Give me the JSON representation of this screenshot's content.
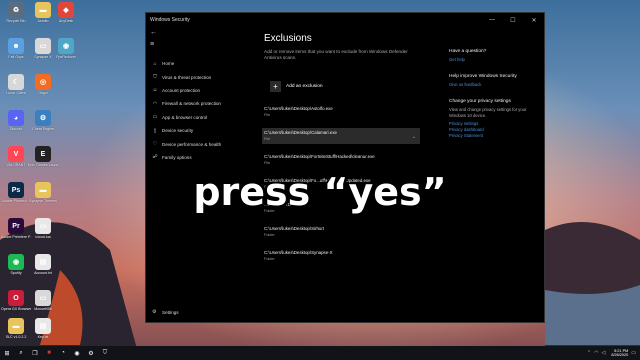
{
  "desktop": {
    "icons": [
      {
        "label": "Recycle Bin",
        "icon": "recycle-bin-icon",
        "color": "#5b6c7d",
        "glyph": "♻"
      },
      {
        "label": "Astolfo",
        "icon": "folder-icon",
        "color": "#e8c45c",
        "glyph": "▬"
      },
      {
        "label": "AnyDesk",
        "icon": "anydesk-icon",
        "color": "#e0463b",
        "glyph": "◆"
      },
      {
        "label": "Fall Guys",
        "icon": "fall-guys-icon",
        "color": "#5aa0e0",
        "glyph": "☻"
      },
      {
        "label": "Synapse X",
        "icon": "file-icon",
        "color": "#d8d8d8",
        "glyph": "▭"
      },
      {
        "label": "FpsReducer",
        "icon": "fps-reducer-icon",
        "color": "#4fa7c7",
        "glyph": "◉"
      },
      {
        "label": "Lunar Client",
        "icon": "lunar-client-icon",
        "color": "#d8d8d8",
        "glyph": "☾"
      },
      {
        "label": "Origin",
        "icon": "origin-icon",
        "color": "#f26c22",
        "glyph": "◎"
      },
      {
        "label": "Discord",
        "icon": "discord-icon",
        "color": "#5865f2",
        "glyph": "◕"
      },
      {
        "label": "Cheat Engine",
        "icon": "cheat-engine-icon",
        "color": "#3a80c0",
        "glyph": "⚙"
      },
      {
        "label": "VALORANT",
        "icon": "valorant-icon",
        "color": "#ff4655",
        "glyph": "V"
      },
      {
        "label": "Epic Games Launcher",
        "icon": "epic-games-icon",
        "color": "#222222",
        "glyph": "E"
      },
      {
        "label": "Adobe Photosh...",
        "icon": "photoshop-icon",
        "color": "#0b2a4a",
        "glyph": "Ps"
      },
      {
        "label": "Synapse Themes",
        "icon": "folder-icon",
        "color": "#e8c45c",
        "glyph": "▬"
      },
      {
        "label": "Adobe Premiere P...",
        "icon": "premiere-icon",
        "color": "#2a0a3a",
        "glyph": "Pr"
      },
      {
        "label": "icloud.lua",
        "icon": "file-icon",
        "color": "#e8e8e8",
        "glyph": "▭"
      },
      {
        "label": "Spotify",
        "icon": "spotify-icon",
        "color": "#1db954",
        "glyph": "◉"
      },
      {
        "label": "Account.txt",
        "icon": "text-file-icon",
        "color": "#e8e8e8",
        "glyph": "▤"
      },
      {
        "label": "Opera GX Browser",
        "icon": "opera-gx-icon",
        "color": "#c81e3c",
        "glyph": "O"
      },
      {
        "label": "MouseKillit",
        "icon": "mouse-icon",
        "color": "#d8d8d8",
        "glyph": "▭"
      },
      {
        "label": "SLC v1.0.2.2",
        "icon": "folder-icon",
        "color": "#e8c45c",
        "glyph": "▬"
      },
      {
        "label": "Key.txt",
        "icon": "text-file-icon",
        "color": "#e8e8e8",
        "glyph": "▤"
      }
    ]
  },
  "window": {
    "title": "Windows Security",
    "minimize": "—",
    "maximize": "☐",
    "close": "✕",
    "back": "←",
    "menu": "≡"
  },
  "sidebar": {
    "items": [
      {
        "label": "Home",
        "icon": "home-icon",
        "glyph": "⌂"
      },
      {
        "label": "Virus & threat protection",
        "icon": "shield-icon",
        "glyph": "⛉"
      },
      {
        "label": "Account protection",
        "icon": "account-icon",
        "glyph": "☺"
      },
      {
        "label": "Firewall & network protection",
        "icon": "network-icon",
        "glyph": "◠"
      },
      {
        "label": "App & browser control",
        "icon": "app-browser-icon",
        "glyph": "▭"
      },
      {
        "label": "Device security",
        "icon": "device-security-icon",
        "glyph": "▯"
      },
      {
        "label": "Device performance & health",
        "icon": "heart-icon",
        "glyph": "♡"
      },
      {
        "label": "Family options",
        "icon": "family-icon",
        "glyph": "☍"
      }
    ],
    "settings": {
      "label": "Settings",
      "icon": "gear-icon",
      "glyph": "⚙"
    }
  },
  "main": {
    "title": "Exclusions",
    "description": "Add or remove items that you want to exclude from Windows Defender Antivirus scans.",
    "add_label": "Add an exclusion",
    "add_glyph": "+",
    "exclusions": [
      {
        "path": "C:\\Users\\lukes\\Desktop\\Astolfo.exe",
        "type": "File"
      },
      {
        "path": "C:\\Users\\lukes\\Desktop\\Calamari.exe",
        "type": "File"
      },
      {
        "path": "C:\\Users\\lukes\\Desktop\\FortniteStuff\\Hacked\\cleanur.exe",
        "type": "File"
      },
      {
        "path": "C:\\Users\\lukes\\Desktop\\Fo...uff\\Hacked\\fnUpdated.exe",
        "type": "File"
      },
      {
        "path": "...\\XRNLWRD",
        "type": "Folder"
      },
      {
        "path": "C:\\Users\\lukes\\Desktop\\Sirhurt",
        "type": "Folder"
      },
      {
        "path": "C:\\Users\\lukes\\Desktop\\Synapse-X",
        "type": "Folder"
      }
    ],
    "chevron": "⌄"
  },
  "right_panel": {
    "question": {
      "heading": "Have a question?",
      "link": "Get help"
    },
    "improve": {
      "heading": "Help improve Windows Security",
      "link": "Give us feedback"
    },
    "privacy": {
      "heading": "Change your privacy settings",
      "text": "View and change privacy settings for your Windows 10 device.",
      "links": [
        "Privacy settings",
        "Privacy dashboard",
        "Privacy Statement"
      ]
    }
  },
  "overlay": {
    "text": "press “yes”"
  },
  "taskbar": {
    "start_glyph": "⊞",
    "icons": [
      {
        "name": "search-icon",
        "glyph": "⌕"
      },
      {
        "name": "task-view-icon",
        "glyph": "❐"
      },
      {
        "name": "app-red-icon",
        "glyph": "■",
        "color": "#d33"
      },
      {
        "name": "steam-icon",
        "glyph": "◔"
      },
      {
        "name": "obs-icon",
        "glyph": "◉"
      },
      {
        "name": "gear-icon",
        "glyph": "⚙"
      },
      {
        "name": "shield-icon",
        "glyph": "⛉"
      }
    ],
    "time": "5:21 PM",
    "date": "8/26/2020"
  },
  "colors": {
    "link": "#4c8fd6",
    "window_bg": "#000000",
    "selected_bg": "#2b2b2b"
  }
}
